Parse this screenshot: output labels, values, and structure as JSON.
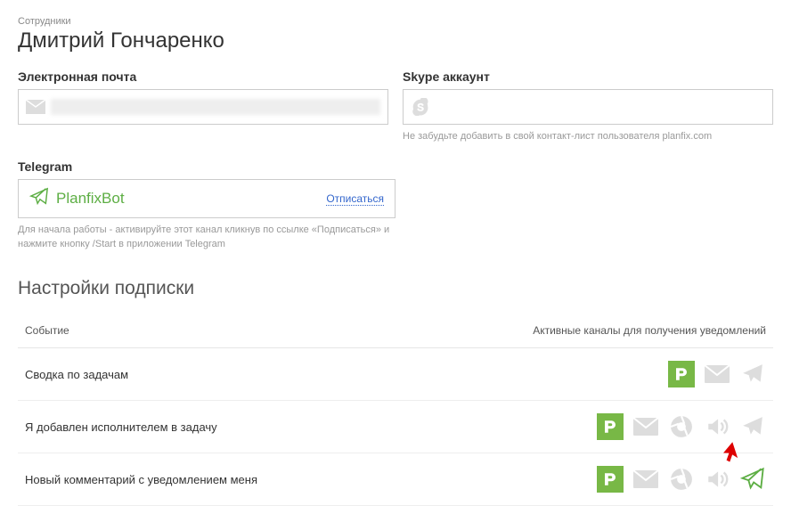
{
  "breadcrumb": "Сотрудники",
  "page_title": "Дмитрий Гончаренко",
  "email": {
    "label": "Электронная почта",
    "value": ""
  },
  "skype": {
    "label": "Skype аккаунт",
    "value": "",
    "hint": "Не забудьте добавить в свой контакт-лист пользователя planfix.com"
  },
  "telegram": {
    "label": "Telegram",
    "bot": "PlanfixBot",
    "unsubscribe": "Отписаться",
    "hint": "Для начала работы - активируйте этот канал кликнув по ссылке «Подписаться» и нажмите кнопку /Start в приложении Telegram"
  },
  "subs": {
    "title": "Настройки подписки",
    "col_event": "Событие",
    "col_channels": "Активные каналы для получения уведомлений",
    "rows": [
      {
        "event": "Сводка по задачам"
      },
      {
        "event": "Я добавлен исполнителем в задачу"
      },
      {
        "event": "Новый комментарий с уведомлением меня"
      }
    ]
  }
}
